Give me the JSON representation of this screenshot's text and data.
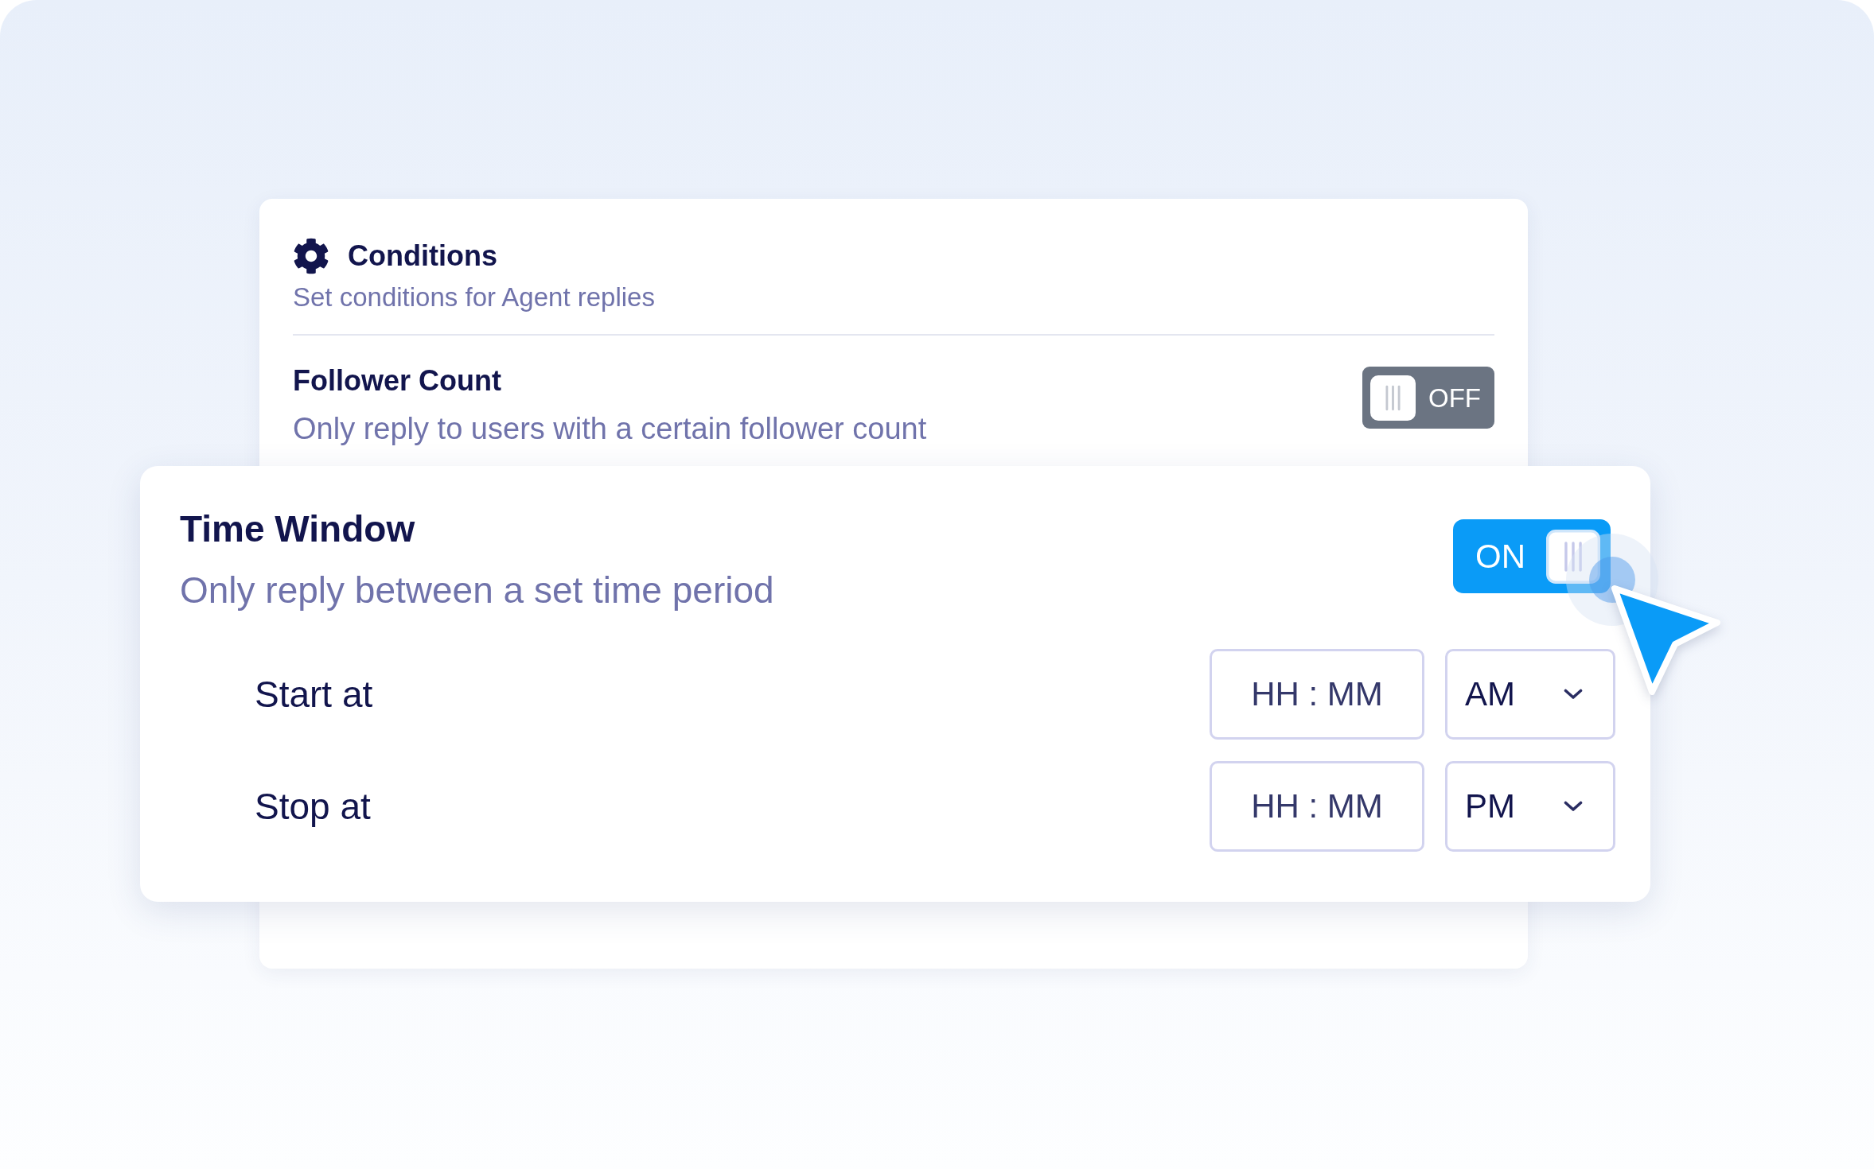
{
  "conditions_panel": {
    "title": "Conditions",
    "subtitle": "Set conditions for Agent replies",
    "follower_count": {
      "title": "Follower Count",
      "description": "Only reply to users with a certain follower count",
      "toggle": {
        "on": false,
        "label": "OFF"
      }
    }
  },
  "time_window": {
    "title": "Time Window",
    "description": "Only reply between a set time period",
    "toggle": {
      "on": true,
      "label": "ON"
    },
    "schedule": [
      {
        "label": "Start at",
        "time": {
          "placeholder": "HH : MM"
        },
        "period": "AM"
      },
      {
        "label": "Stop at",
        "time": {
          "placeholder": "HH : MM"
        },
        "period": "PM"
      }
    ]
  }
}
